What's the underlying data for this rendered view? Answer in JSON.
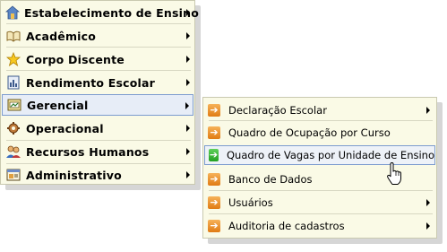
{
  "main_menu": {
    "items": [
      {
        "label": "Estabelecimento de Ensino",
        "icon": "school-house-icon"
      },
      {
        "label": "Acadêmico",
        "icon": "book-icon"
      },
      {
        "label": "Corpo Discente",
        "icon": "star-icon"
      },
      {
        "label": "Rendimento Escolar",
        "icon": "report-icon"
      },
      {
        "label": "Gerencial",
        "icon": "management-icon"
      },
      {
        "label": "Operacional",
        "icon": "gear-icon"
      },
      {
        "label": "Recursos Humanos",
        "icon": "people-icon"
      },
      {
        "label": "Administrativo",
        "icon": "admin-window-icon"
      }
    ],
    "active_item": "Gerencial"
  },
  "submenu": {
    "parent": "Gerencial",
    "items": [
      {
        "label": "Declaração Escolar",
        "has_submenu": true
      },
      {
        "label": "Quadro de Ocupação por Curso",
        "has_submenu": false
      },
      {
        "label": "Quadro de Vagas por Unidade de Ensino",
        "has_submenu": false
      },
      {
        "label": "Banco de Dados",
        "has_submenu": false
      },
      {
        "label": "Usuários",
        "has_submenu": true
      },
      {
        "label": "Auditoria de cadastros",
        "has_submenu": true
      }
    ],
    "hovered_item": "Quadro de Vagas por Unidade de Ensino"
  },
  "colors": {
    "menu_background": "#fafae6",
    "highlight_border": "#7d9ccf",
    "highlight_fill": "#e7edf7",
    "orange_arrow_icon": "#e88a1d",
    "green_arrow_icon": "#2fae2c"
  },
  "cursor": "hand-pointer-icon"
}
